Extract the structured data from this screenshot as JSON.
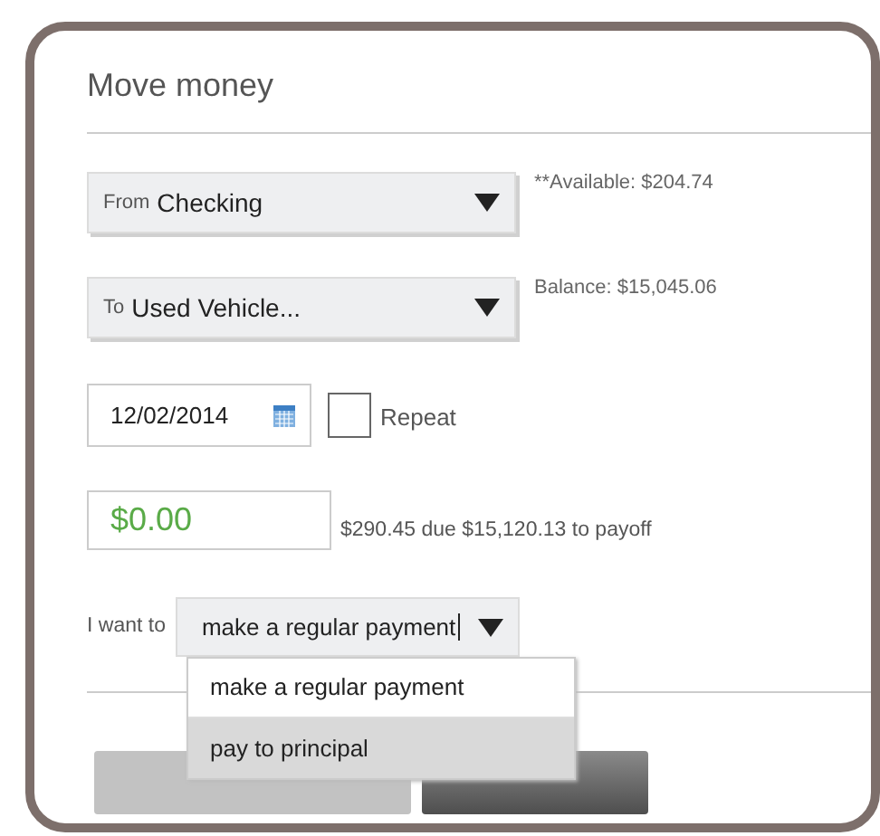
{
  "title": "Move money",
  "from": {
    "label": "From",
    "value": "Checking",
    "note": "**Available: $204.74"
  },
  "to": {
    "label": "To",
    "value": "Used Vehicle...",
    "note": "Balance: $15,045.06"
  },
  "date": {
    "value": "12/02/2014"
  },
  "repeat": {
    "label": "Repeat",
    "checked": false
  },
  "amount": {
    "value": "$0.00",
    "note": "$290.45 due $15,120.13 to payoff"
  },
  "intent": {
    "label": "I want to",
    "value": "make a regular payment",
    "expanded": true,
    "options": [
      {
        "label": "make a regular payment",
        "highlighted": false
      },
      {
        "label": "pay to principal",
        "highlighted": true
      }
    ]
  },
  "buttons": [
    {
      "kind": "primary",
      "disabled": true
    },
    {
      "kind": "secondary"
    }
  ]
}
